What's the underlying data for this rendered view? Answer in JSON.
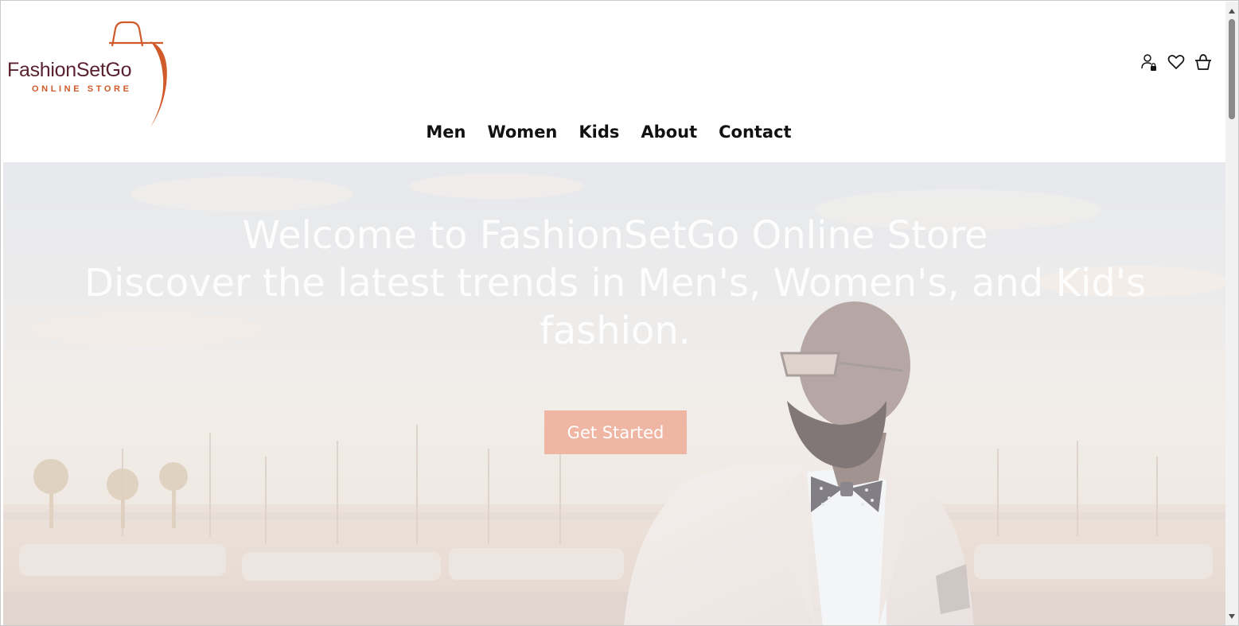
{
  "logo": {
    "word": "FashionSetGo",
    "sub": "ONLINE STORE",
    "colors": {
      "word": "#5a2230",
      "accent": "#d05a2a"
    }
  },
  "header_icons": [
    {
      "name": "user-lock-icon"
    },
    {
      "name": "heart-icon"
    },
    {
      "name": "basket-icon"
    }
  ],
  "nav": {
    "items": [
      "Men",
      "Women",
      "Kids",
      "About",
      "Contact"
    ]
  },
  "hero": {
    "title_line1": "Welcome to FashionSetGo Online Store",
    "title_line2": "Discover the latest trends in Men's, Women's, and Kid's fashion.",
    "cta_label": "Get Started",
    "colors": {
      "cta": "#efb7a3"
    }
  }
}
